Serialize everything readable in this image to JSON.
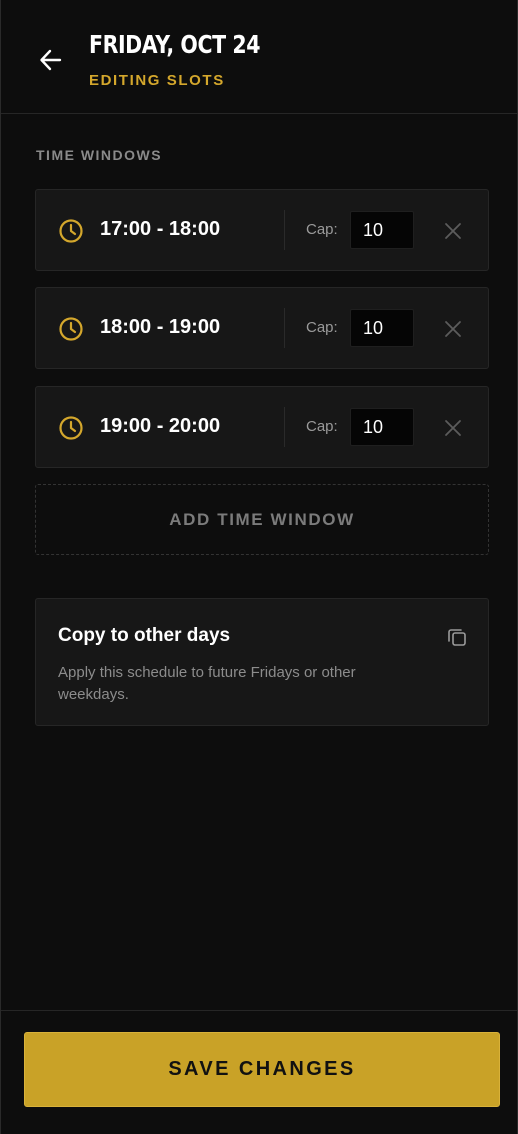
{
  "header": {
    "title": "FRIDAY, OCT 24",
    "subtitle": "EDITING SLOTS",
    "back_icon": "arrow-left-icon"
  },
  "section": {
    "label": "TIME WINDOWS"
  },
  "slots": [
    {
      "range": "17:00 - 18:00",
      "cap_label": "Cap:",
      "cap_value": "10"
    },
    {
      "range": "18:00 - 19:00",
      "cap_label": "Cap:",
      "cap_value": "10"
    },
    {
      "range": "19:00 - 20:00",
      "cap_label": "Cap:",
      "cap_value": "10"
    }
  ],
  "add_window": {
    "label": "ADD TIME WINDOW"
  },
  "copy_card": {
    "title": "Copy to other days",
    "description": "Apply this schedule to future Fridays or other weekdays.",
    "icon": "copy-icon"
  },
  "footer": {
    "save_label": "SAVE CHANGES"
  },
  "colors": {
    "accent": "#d4a72c",
    "button_bg": "#c9a227",
    "background": "#0d0d0d",
    "card": "#171717"
  }
}
